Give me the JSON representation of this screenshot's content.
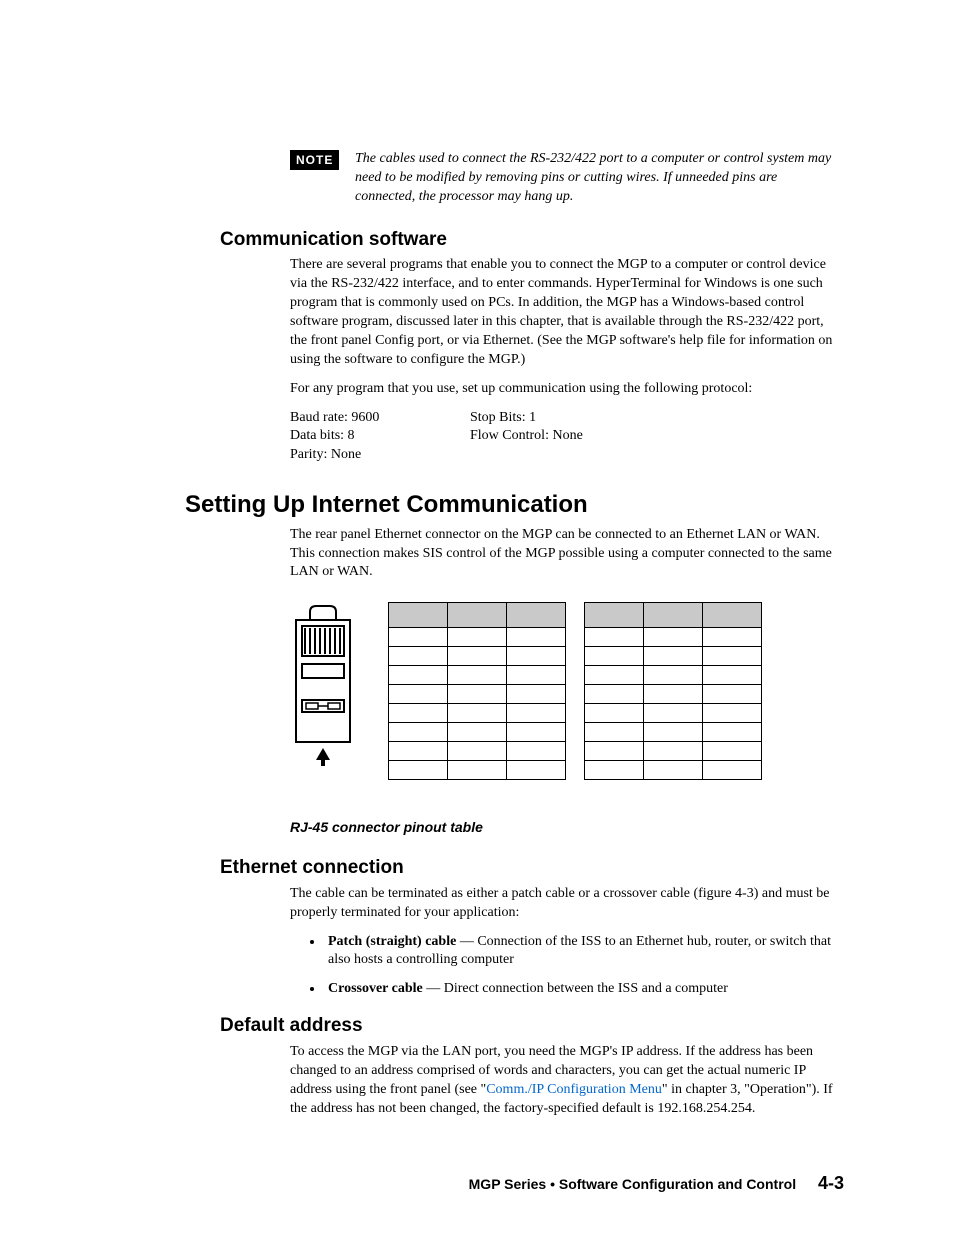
{
  "note": {
    "badge": "NOTE",
    "text": "The cables used to connect the RS-232/422 port to a computer or control system may need to be modified by removing pins or cutting wires.  If unneeded pins are connected, the processor may hang up."
  },
  "comm_software": {
    "heading": "Communication software",
    "p1": "There are several programs that enable you to connect the MGP to a computer or control device via the RS-232/422 interface, and to enter commands.  HyperTerminal for Windows is one such program that is commonly used on PCs.  In addition, the MGP has a Windows-based control software program, discussed later in this chapter, that is available through the RS-232/422 port, the front panel Config port, or via Ethernet.  (See the MGP software's help file for information on using the software to configure the MGP.)",
    "p2": "For any program that you use, set up communication using the following protocol:",
    "protocol": {
      "col1_l1": "Baud rate:  9600",
      "col1_l2": "Data bits:  8",
      "col1_l3": "Parity:  None",
      "col2_l1": "Stop Bits:  1",
      "col2_l2": "Flow Control:  None"
    }
  },
  "internet": {
    "heading": "Setting Up Internet Communication",
    "p1": "The rear panel Ethernet connector on the MGP can be connected to an Ethernet LAN or WAN.  This connection makes SIS control of the MGP possible using a computer connected to the same LAN or WAN.",
    "fig_caption": "RJ-45 connector pinout table"
  },
  "ethernet": {
    "heading": "Ethernet connection",
    "p1": "The cable can be terminated as either a patch cable or a crossover cable (figure 4-3) and must be properly terminated for your application:",
    "b1_strong": "Patch (straight) cable",
    "b1_rest": " — Connection of the ISS to an Ethernet hub, router, or switch that also hosts a controlling computer",
    "b2_strong": "Crossover cable",
    "b2_rest": " — Direct connection between the ISS and a computer"
  },
  "default_addr": {
    "heading": "Default address",
    "p1a": "To access the MGP via the LAN port, you need the MGP's IP address.  If the address has been changed to an address comprised of words and characters, you can get the actual numeric IP address using the front panel (see \"",
    "link": "Comm./IP Configuration Menu",
    "p1b": "\" in chapter 3, \"Operation\").  If the address has not been changed, the factory-specified default is 192.168.254.254."
  },
  "footer": {
    "chapter": "MGP Series • Software Configuration and Control",
    "page": "4-3"
  }
}
